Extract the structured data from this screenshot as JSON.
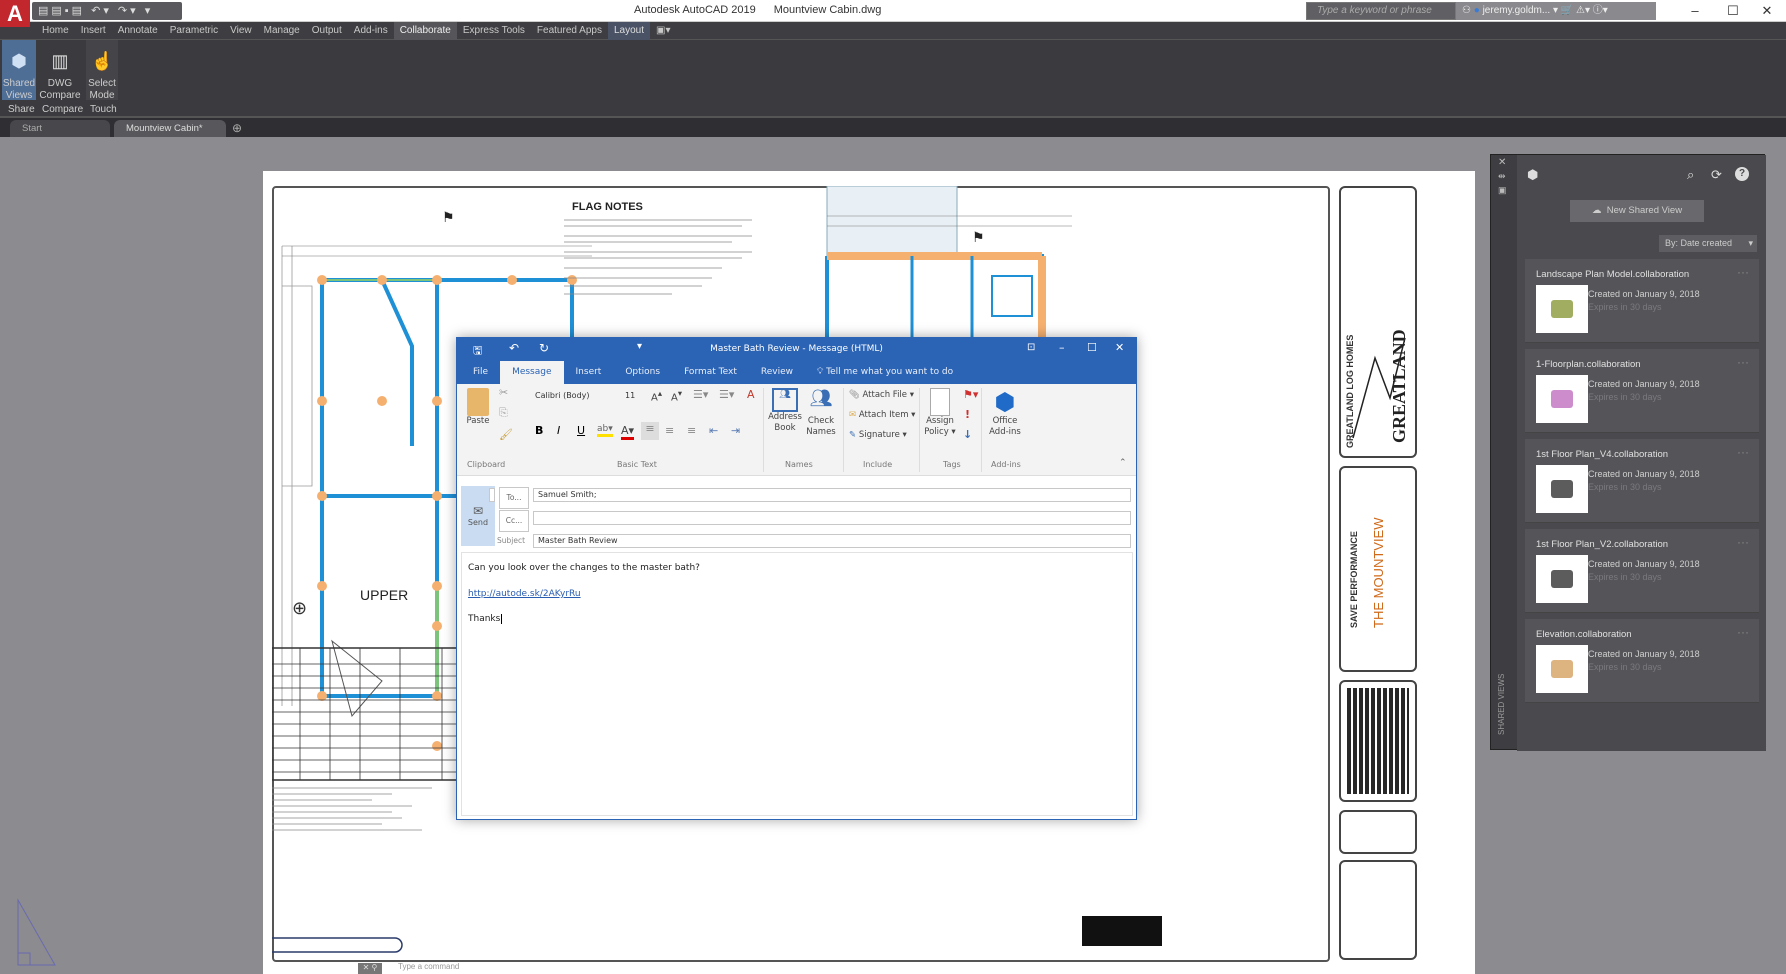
{
  "app": {
    "logo": "A",
    "title": "Autodesk AutoCAD 2019",
    "file": "Mountview Cabin.dwg",
    "search_placeholder": "Type a keyword or phrase",
    "user": "jeremy.goldm...",
    "qat_icons": [
      "new-icon",
      "open-icon",
      "save-icon",
      "print-icon",
      "undo-icon",
      "redo-icon"
    ]
  },
  "ribbon": {
    "tabs": [
      "Home",
      "Insert",
      "Annotate",
      "Parametric",
      "View",
      "Manage",
      "Output",
      "Add-ins",
      "Collaborate",
      "Express Tools",
      "Featured Apps",
      "Layout"
    ],
    "active_tab": "Collaborate",
    "buttons": [
      {
        "label1": "Shared",
        "label2": "Views",
        "group": "Share"
      },
      {
        "label1": "DWG",
        "label2": "Compare",
        "group": "Compare"
      },
      {
        "label1": "Select",
        "label2": "Mode",
        "group": "Touch"
      }
    ]
  },
  "doc_tabs": [
    "Start",
    "Mountview Cabin*"
  ],
  "drawing": {
    "flag_notes_title": "FLAG NOTES",
    "plan_title": "UPPER",
    "title_block": {
      "company": "GREATLAND LOG HOMES",
      "logo_text": "GREATLAND",
      "project": "THE MOUNTVIEW",
      "series": "SAVE PERFORMANCE"
    }
  },
  "outlook": {
    "title": "Master Bath Review  -  Message (HTML)",
    "tabs": [
      "File",
      "Message",
      "Insert",
      "Options",
      "Format Text",
      "Review"
    ],
    "active_tab": "Message",
    "tell_me": "Tell me what you want to do",
    "font": "Calibri (Body)",
    "font_size": "11",
    "ribbon": {
      "paste": "Paste",
      "address_book": [
        "Address",
        "Book"
      ],
      "check_names": [
        "Check",
        "Names"
      ],
      "attach_file": "Attach File",
      "attach_item": "Attach Item",
      "signature": "Signature",
      "assign_policy": [
        "Assign",
        "Policy"
      ],
      "office_addins": [
        "Office",
        "Add-ins"
      ],
      "groups": [
        "Clipboard",
        "Basic Text",
        "Names",
        "Include",
        "Tags",
        "Add-ins"
      ],
      "format_buttons": [
        "B",
        "I",
        "U"
      ]
    },
    "send": "Send",
    "to_label": "To...",
    "cc_label": "Cc...",
    "subject_label": "Subject",
    "to_value": "Samuel Smith;",
    "cc_value": "",
    "subject_value": "Master Bath Review",
    "body_line1": "Can you look over the changes to the master bath?",
    "body_link": "http://autode.sk/2AKyrRu",
    "body_line3": "Thanks"
  },
  "shared_views": {
    "new_button": "New Shared View",
    "sort": "By: Date created",
    "side_label": "SHARED VIEWS",
    "items": [
      {
        "name": "Landscape Plan Model.collaboration",
        "created": "Created on January 9, 2018",
        "expires": "Expires in 30 days"
      },
      {
        "name": "1-Floorplan.collaboration",
        "created": "Created on January 9, 2018",
        "expires": "Expires in 30 days"
      },
      {
        "name": "1st Floor Plan_V4.collaboration",
        "created": "Created on January 9, 2018",
        "expires": "Expires in 30 days"
      },
      {
        "name": "1st Floor Plan_V2.collaboration",
        "created": "Created on January 9, 2018",
        "expires": "Expires in 30 days"
      },
      {
        "name": "Elevation.collaboration",
        "created": "Created on January 9, 2018",
        "expires": "Expires in 30 days"
      }
    ]
  },
  "command_line": {
    "placeholder": "Type a command"
  },
  "colors": {
    "outlook_blue": "#2b63b5",
    "autocad_red": "#c1272d",
    "wall_blue": "#1e90d6",
    "log_orange": "#f5b070"
  }
}
